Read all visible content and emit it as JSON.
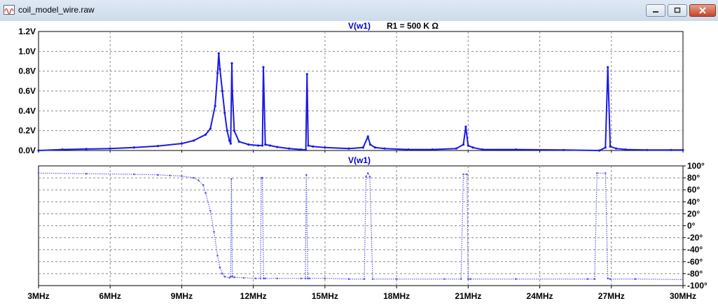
{
  "window": {
    "title": "coil_model_wire.raw",
    "controls": {
      "minimize": "minimize",
      "maximize": "maximize",
      "close": "close"
    }
  },
  "colors": {
    "trace": "#1a1ae6",
    "phase_trace": "#5a5aee",
    "grid": "#8a8a8a",
    "background": "#ffffff",
    "title_trace": "#0000cc"
  },
  "chart_data": [
    {
      "type": "line",
      "title": "V(w1)",
      "annotation": "R1 = 500 K Ω",
      "xlabel": "",
      "ylabel": "",
      "xlim": [
        3,
        30
      ],
      "ylim": [
        0,
        1.2
      ],
      "x_unit": "MHz",
      "x_ticks": [
        "3MHz",
        "6MHz",
        "9MHz",
        "12MHz",
        "15MHz",
        "18MHz",
        "21MHz",
        "24MHz",
        "27MHz",
        "30MHz"
      ],
      "y_ticks": [
        "0.0V",
        "0.2V",
        "0.4V",
        "0.6V",
        "0.8V",
        "1.0V",
        "1.2V"
      ],
      "grid": true,
      "series": [
        {
          "name": "V(w1)",
          "x": [
            3,
            4,
            5,
            6,
            7,
            8,
            9,
            9.5,
            10,
            10.2,
            10.4,
            10.5,
            10.55,
            10.6,
            10.7,
            10.8,
            10.9,
            11.0,
            11.05,
            11.1,
            11.12,
            11.2,
            11.4,
            11.8,
            12.2,
            12.38,
            12.42,
            12.5,
            12.7,
            13,
            13.5,
            14.0,
            14.2,
            14.25,
            14.3,
            14.5,
            15,
            16,
            16.6,
            16.8,
            16.9,
            17.1,
            17.5,
            18.5,
            19.5,
            20.5,
            20.8,
            20.9,
            21.0,
            21.2,
            21.6,
            23,
            25,
            26.5,
            26.75,
            26.85,
            26.95,
            27.2,
            27.6,
            28.5,
            29.5,
            30
          ],
          "y": [
            0.0,
            0.01,
            0.015,
            0.02,
            0.03,
            0.045,
            0.07,
            0.1,
            0.16,
            0.22,
            0.45,
            0.78,
            0.98,
            0.82,
            0.6,
            0.38,
            0.2,
            0.1,
            0.07,
            0.88,
            0.6,
            0.2,
            0.09,
            0.06,
            0.05,
            0.05,
            0.84,
            0.06,
            0.05,
            0.035,
            0.02,
            0.01,
            0.005,
            0.77,
            0.05,
            0.04,
            0.03,
            0.02,
            0.03,
            0.14,
            0.06,
            0.03,
            0.02,
            0.01,
            0.01,
            0.02,
            0.06,
            0.24,
            0.05,
            0.03,
            0.01,
            0.01,
            0.005,
            0.0,
            0.03,
            0.84,
            0.04,
            0.02,
            0.01,
            0.005,
            0.005,
            0.005
          ]
        }
      ]
    },
    {
      "type": "line",
      "title": "V(w1)",
      "xlabel": "",
      "ylabel": "",
      "xlim": [
        3,
        30
      ],
      "ylim": [
        -100,
        100
      ],
      "x_unit": "MHz",
      "y_unit": "°",
      "x_ticks": [
        "3MHz",
        "6MHz",
        "9MHz",
        "12MHz",
        "15MHz",
        "18MHz",
        "21MHz",
        "24MHz",
        "27MHz",
        "30MHz"
      ],
      "y_ticks": [
        "100°",
        "80°",
        "60°",
        "40°",
        "20°",
        "0°",
        "-20°",
        "-40°",
        "-60°",
        "-80°",
        "-100°"
      ],
      "grid": true,
      "series": [
        {
          "name": "V(w1)",
          "x": [
            3,
            5,
            7,
            8,
            8.5,
            9,
            9.5,
            9.7,
            9.9,
            10.0,
            10.2,
            10.35,
            10.5,
            10.6,
            10.7,
            10.8,
            11.0,
            11.05,
            11.08,
            11.12,
            11.2,
            11.6,
            12.1,
            12.3,
            12.33,
            12.38,
            12.43,
            12.5,
            13,
            14.0,
            14.18,
            14.22,
            14.28,
            14.35,
            15,
            16,
            16.65,
            16.72,
            16.8,
            16.88,
            17.0,
            18,
            20,
            20.7,
            20.8,
            20.95,
            21.0,
            21.1,
            23,
            26.0,
            26.3,
            26.4,
            26.75,
            26.85,
            26.95,
            28,
            30
          ],
          "y": [
            88,
            87,
            86,
            85,
            84,
            83,
            80,
            76,
            68,
            55,
            25,
            -10,
            -50,
            -70,
            -80,
            -85,
            -87,
            -85,
            78,
            -85,
            -86,
            -87,
            -88,
            -88,
            80,
            80,
            -88,
            -88,
            -88,
            -88,
            -88,
            85,
            -88,
            -88,
            -88,
            -89,
            -89,
            82,
            88,
            82,
            -89,
            -89,
            -89,
            -89,
            86,
            86,
            -89,
            -89,
            -89,
            -89,
            -89,
            88,
            88,
            -88,
            -89,
            -89,
            -90
          ]
        }
      ]
    }
  ]
}
